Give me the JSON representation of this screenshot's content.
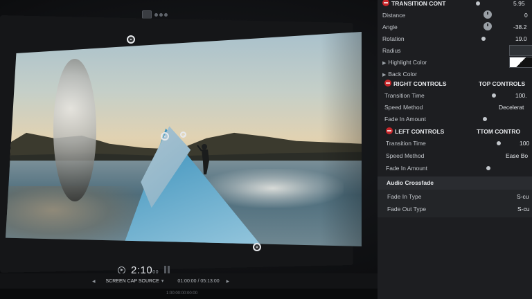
{
  "viewer": {
    "timecode": "2:10",
    "timecode_frames": "00",
    "source_label": "SCREEN CAP SOURCE",
    "duration": "01:00:00 / 05:13:00",
    "strip_timecode": "1:00:00:00:00:00"
  },
  "inspector": {
    "transition_controls": "TRANSITION CONT",
    "transition_value": "5.95",
    "distance": {
      "label": "Distance",
      "value": "0"
    },
    "angle": {
      "label": "Angle",
      "value": "-38.2"
    },
    "rotation": {
      "label": "Rotation",
      "value": "19.0"
    },
    "radius": {
      "label": "Radius"
    },
    "highlight_color": {
      "label": "Highlight Color"
    },
    "back_color": {
      "label": "Back Color"
    },
    "right_controls": {
      "label": "RIGHT CONTROLS",
      "value": "TOP CONTROLS"
    },
    "right_transition_time": {
      "label": "Transition Time",
      "value": "100."
    },
    "right_speed_method": {
      "label": "Speed Method",
      "value": "Decelerat"
    },
    "right_fade_in": {
      "label": "Fade In Amount"
    },
    "left_controls": {
      "label": "LEFT CONTROLS",
      "value": "TTOM CONTRO"
    },
    "left_transition_time": {
      "label": "Transition Time",
      "value": "100"
    },
    "left_speed_method": {
      "label": "Speed Method",
      "value": "Ease Bo"
    },
    "left_fade_in": {
      "label": "Fade In Amount"
    },
    "audio_crossfade": "Audio Crossfade",
    "fade_in_type": {
      "label": "Fade In Type",
      "value": "S-cu"
    },
    "fade_out_type": {
      "label": "Fade Out Type",
      "value": "S-cu"
    }
  }
}
